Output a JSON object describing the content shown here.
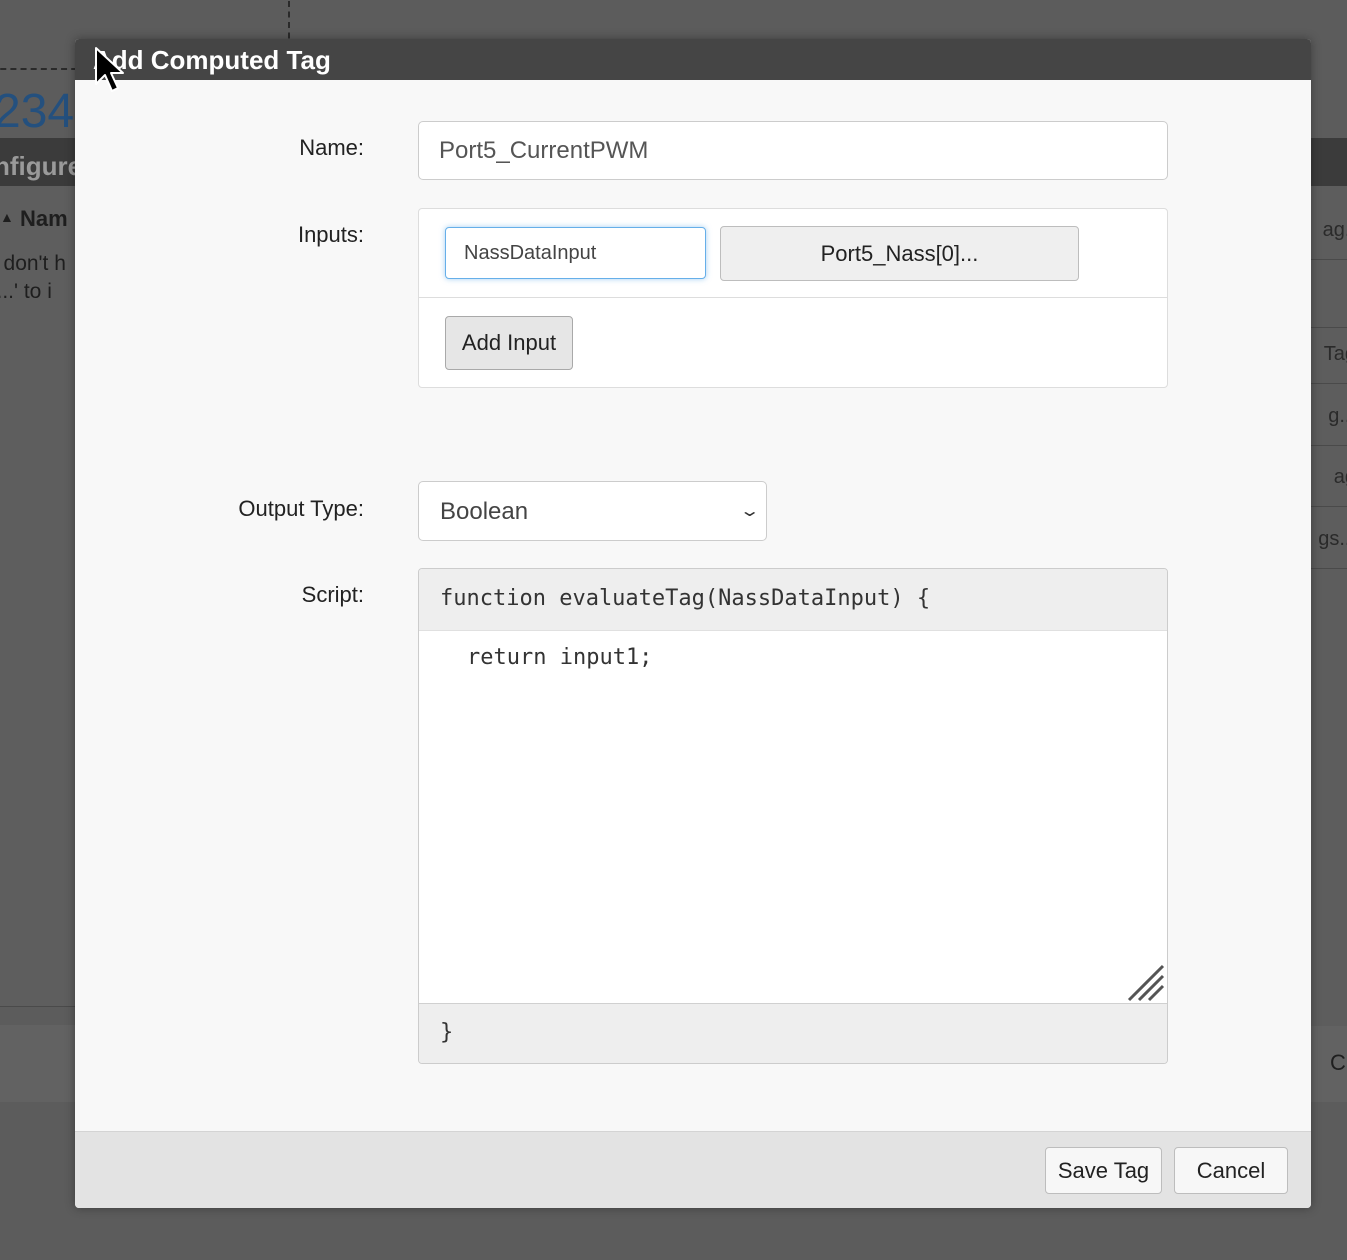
{
  "background": {
    "number": "234",
    "configure_title": "nfigure",
    "column_header": "Nam",
    "empty_line1": "n don't h",
    "empty_line2": "s...' to i",
    "right_items": [
      "ag..",
      "",
      "Tag",
      "g...",
      "ag",
      "gs..."
    ],
    "right_c": "C"
  },
  "dialog": {
    "title": "Add Computed Tag",
    "name": {
      "label": "Name:",
      "value": "Port5_CurrentPWM"
    },
    "inputs": {
      "label": "Inputs:",
      "rows": [
        {
          "name": "NassDataInput",
          "tag": "Port5_Nass[0]..."
        }
      ],
      "add_label": "Add Input"
    },
    "output_type": {
      "label": "Output Type:",
      "value": "Boolean"
    },
    "script": {
      "label": "Script:",
      "header": "function evaluateTag(NassDataInput) {",
      "body": "return input1;",
      "footer": "}"
    },
    "buttons": {
      "save": "Save Tag",
      "cancel": "Cancel"
    }
  }
}
